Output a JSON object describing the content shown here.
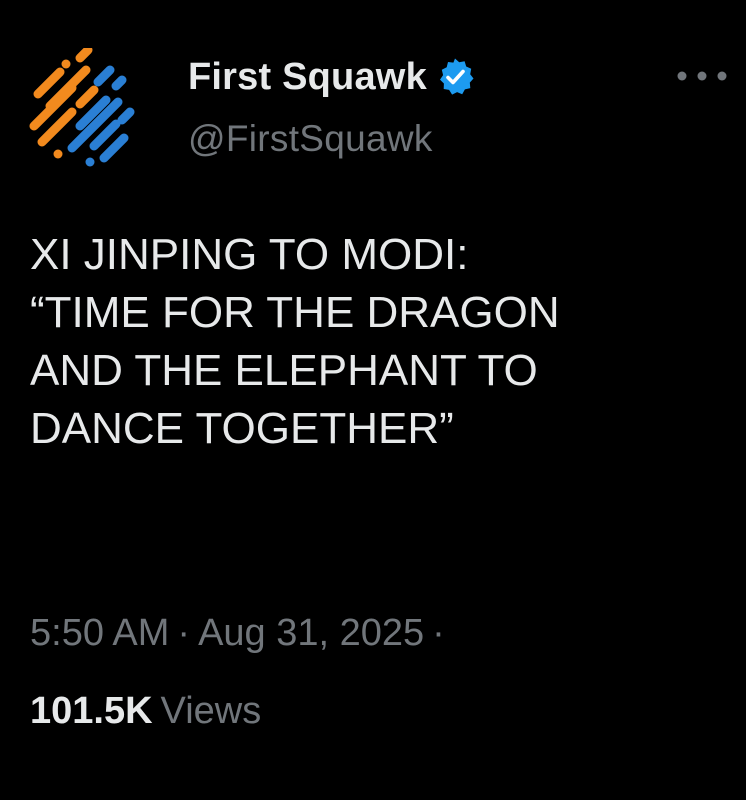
{
  "author": {
    "display_name": "First Squawk",
    "handle": "@FirstSquawk",
    "verified": true,
    "avatar_icon": "first-squawk-logo-icon",
    "verified_icon": "verified-badge-icon"
  },
  "menu": {
    "more_icon": "more-options-icon"
  },
  "tweet": {
    "text": "XI JINPING TO MODI:\n“TIME FOR THE DRAGON\nAND THE ELEPHANT TO\nDANCE TOGETHER”"
  },
  "meta": {
    "time": "5:50 AM",
    "separator": "·",
    "date": "Aug 31, 2025",
    "trailing_separator": "·"
  },
  "stats": {
    "views_count": "101.5K",
    "views_label": "Views"
  },
  "colors": {
    "background": "#000000",
    "primary_text": "#e7e9ea",
    "secondary_text": "#71767b",
    "verified_blue": "#1d9bf0",
    "logo_orange": "#f28a1e",
    "logo_blue": "#2a7fd4"
  }
}
